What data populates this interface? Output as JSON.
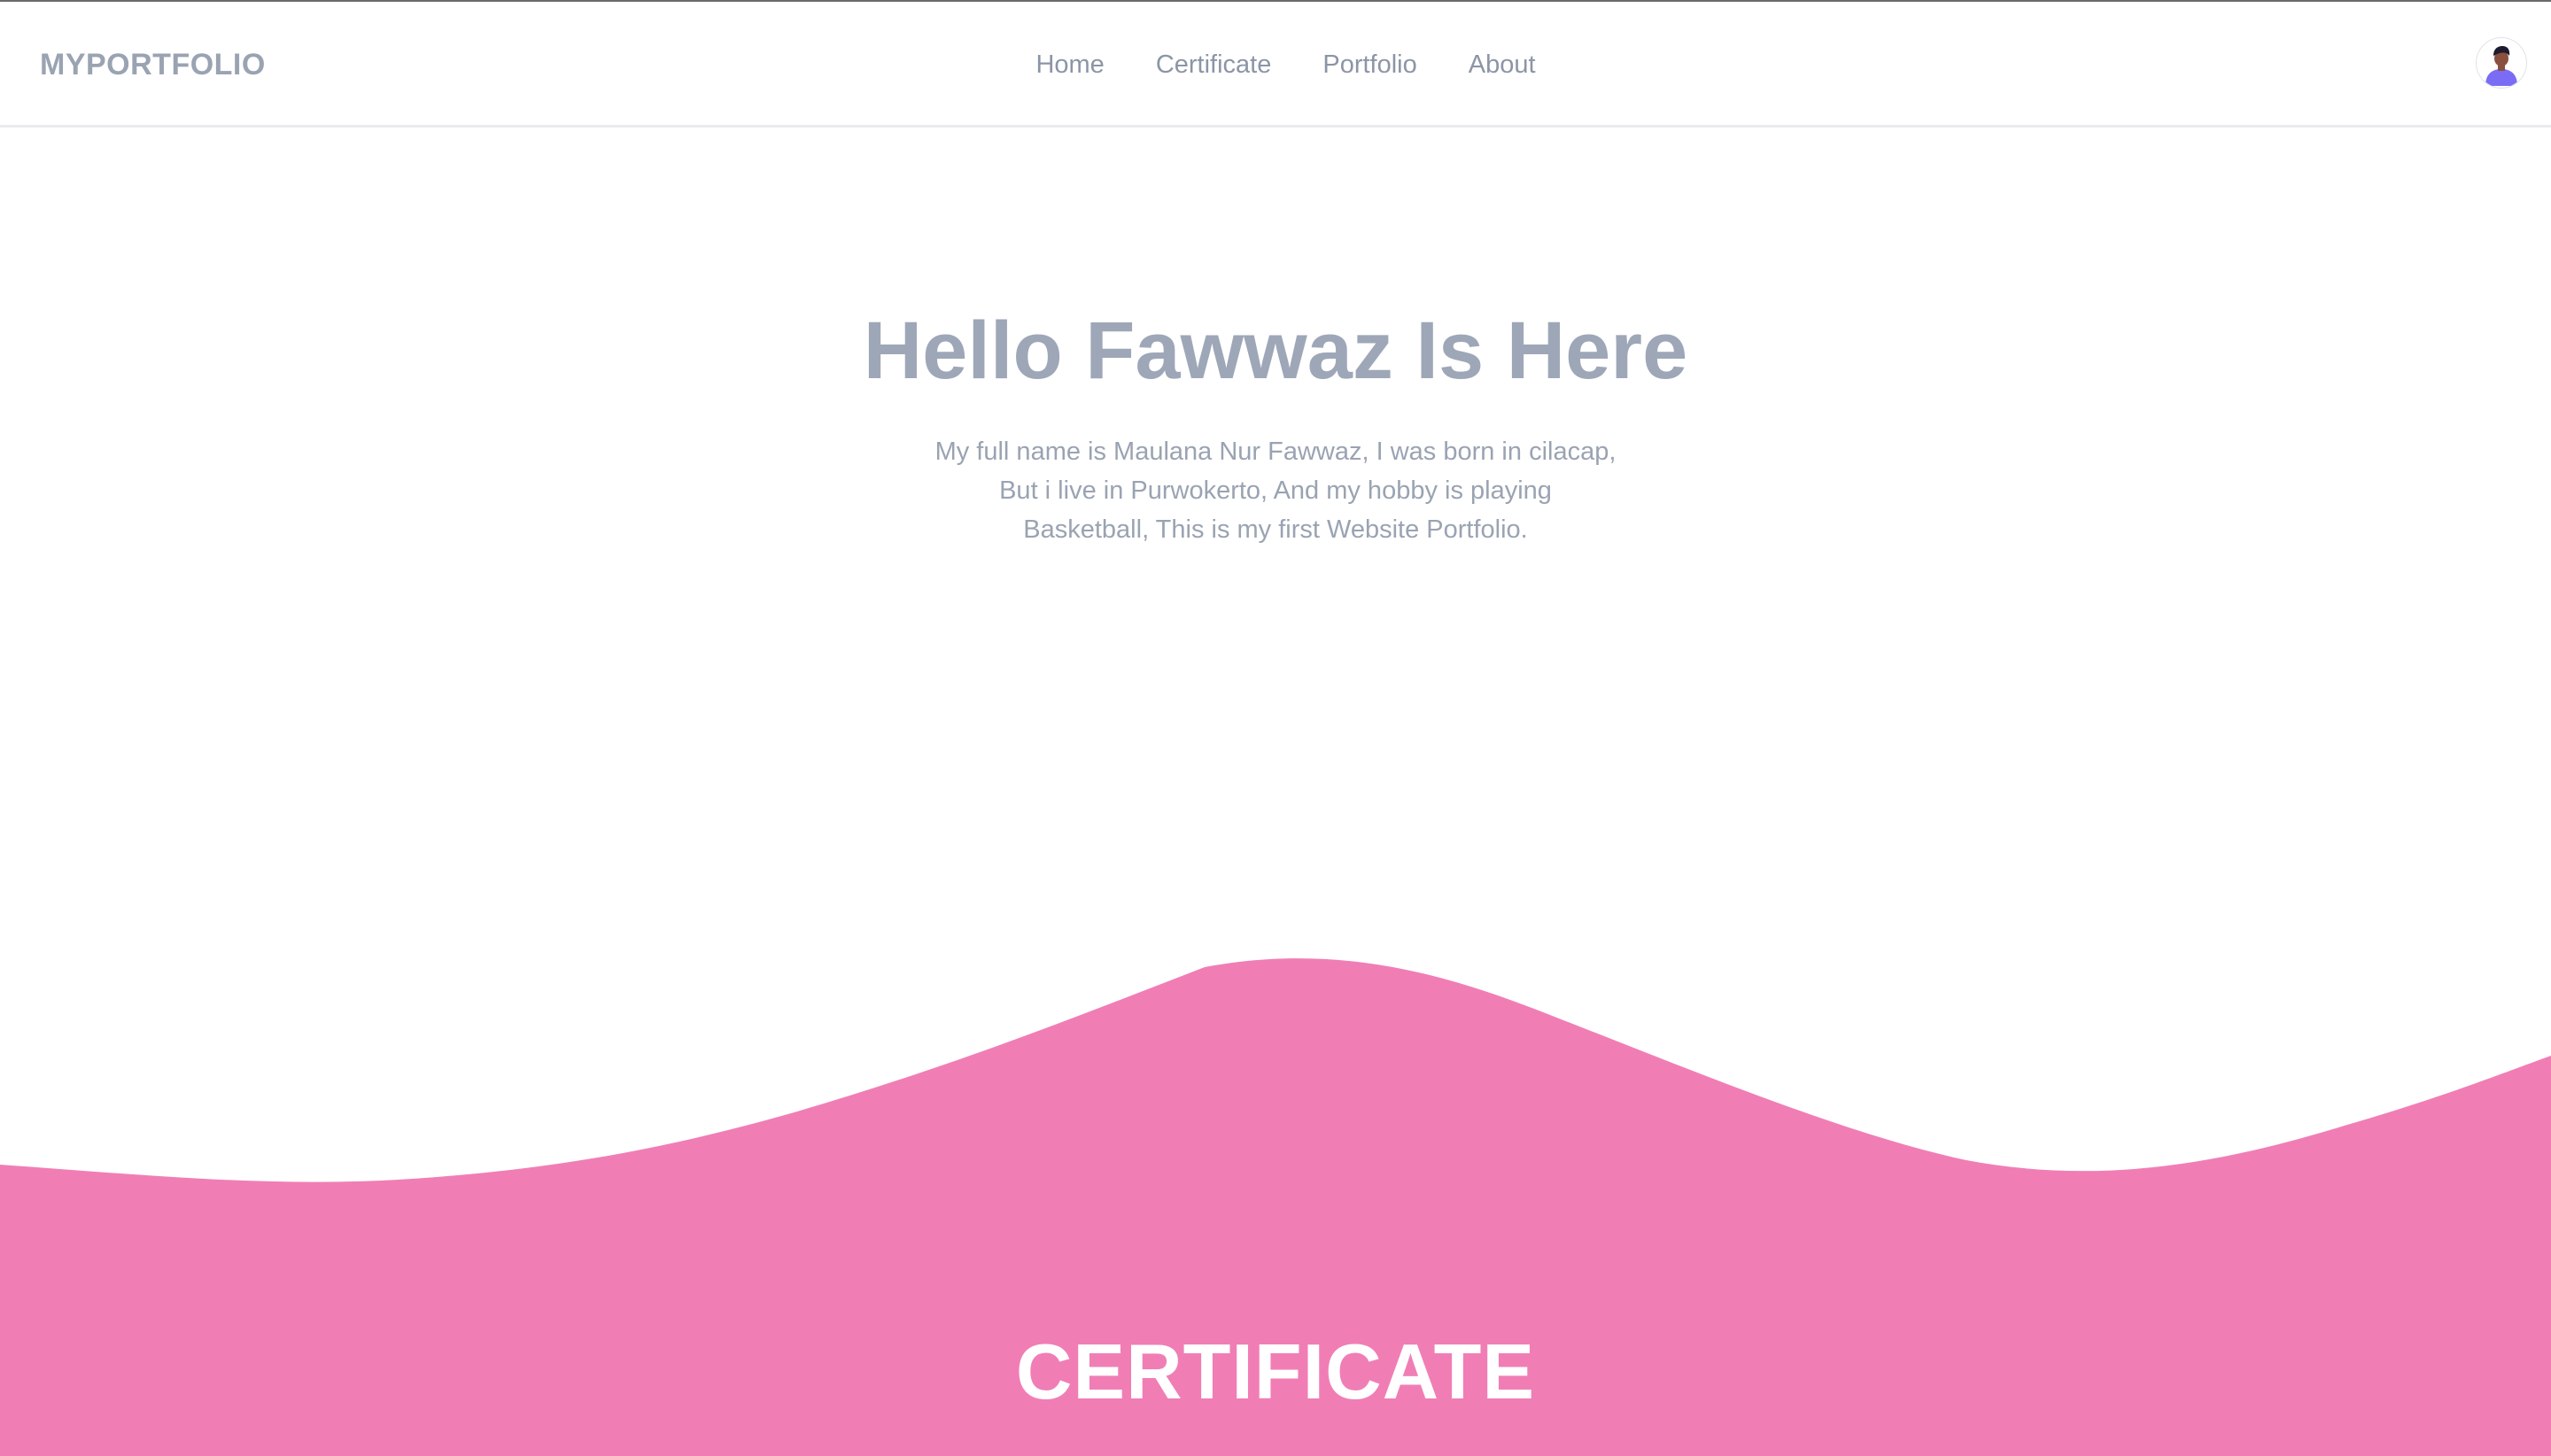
{
  "navbar": {
    "brand": "MYPORTFOLIO",
    "links": [
      "Home",
      "Certificate",
      "Portfolio",
      "About"
    ],
    "avatar_icon": "user-avatar-icon"
  },
  "hero": {
    "title": "Hello Fawwaz Is Here",
    "lines": [
      "My full name is Maulana Nur Fawwaz, I was born in cilacap,",
      "But i live in Purwokerto, And my hobby is playing",
      "Basketball, This is my first Website Portfolio."
    ]
  },
  "certificate": {
    "title": "CERTIFICATE"
  },
  "colors": {
    "wave": "#f07eb5",
    "text_gray": "#9aa3b2",
    "background": "#ffffff"
  }
}
